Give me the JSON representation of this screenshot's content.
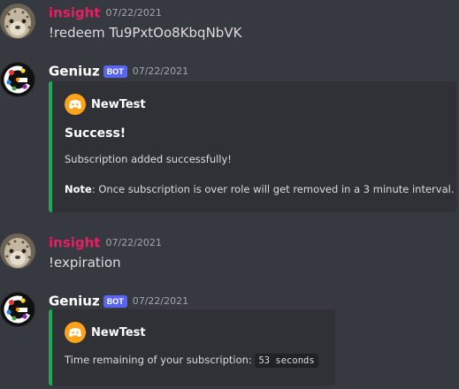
{
  "messages": [
    {
      "username": "insight",
      "timestamp": "07/22/2021",
      "content": "!redeem Tu9PxtOo8KbqNbVK"
    },
    {
      "username": "Geniuz",
      "badge": "BOT",
      "timestamp": "07/22/2021",
      "embed": {
        "author": "NewTest",
        "title": "Success!",
        "description": "Subscription added successfully!",
        "note_label": "Note",
        "note_text": ": Once subscription is over role will get removed in a 3 minute interval.",
        "accent_color": "#21a659"
      }
    },
    {
      "username": "insight",
      "timestamp": "07/22/2021",
      "content": "!expiration"
    },
    {
      "username": "Geniuz",
      "badge": "BOT",
      "timestamp": "07/22/2021",
      "embed": {
        "author": "NewTest",
        "description": "Time remaining of your subscription:",
        "code_value": "53 seconds",
        "accent_color": "#21a659"
      }
    }
  ],
  "icons": {
    "user_avatar": "snow-leopard-avatar",
    "bot_avatar": "colorful-g-logo-avatar",
    "embed_author_icon": "discord-logo-icon"
  },
  "colors": {
    "background": "#36393f",
    "embed_background": "#2f3136",
    "insight_username": "#e91e63",
    "bot_badge": "#5865f2",
    "author_icon": "#ffa31a"
  }
}
